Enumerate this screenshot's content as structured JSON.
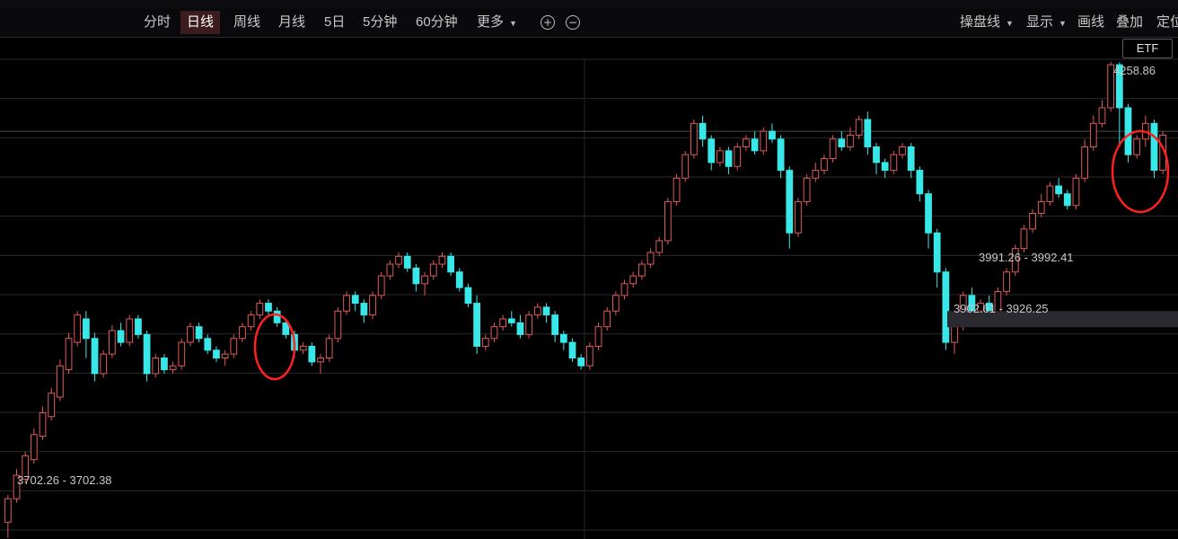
{
  "toolbar": {
    "tabs": [
      {
        "label": "分时",
        "active": false
      },
      {
        "label": "日线",
        "active": true
      },
      {
        "label": "周线",
        "active": false
      },
      {
        "label": "月线",
        "active": false
      },
      {
        "label": "5日",
        "active": false
      },
      {
        "label": "5分钟",
        "active": false
      },
      {
        "label": "60分钟",
        "active": false
      },
      {
        "label": "更多",
        "active": false
      }
    ],
    "zoom_in_icon": "plus-circle-icon",
    "zoom_out_icon": "minus-circle-icon",
    "right_items": [
      {
        "label": "操盘线",
        "dropdown": true
      },
      {
        "label": "显示",
        "dropdown": true
      },
      {
        "label": "画线",
        "dropdown": false
      },
      {
        "label": "叠加",
        "dropdown": false
      },
      {
        "label": "定位",
        "dropdown": false
      }
    ]
  },
  "etf_tag": "ETF",
  "chart_data": {
    "type": "candlestick",
    "high_label": "4258.86",
    "range_labels": [
      "3991.26 - 3992.41",
      "3902.61 - 3926.25",
      "3702.26 - 3702.38"
    ],
    "ylim": [
      3660,
      4262
    ],
    "colors": {
      "up": "#e05a5a",
      "down": "#38e8e8",
      "highlight": "#ff2020",
      "grid": "#2a2a2e"
    },
    "candles": [
      [
        3670,
        3700,
        3650,
        3705
      ],
      [
        3700,
        3730,
        3695,
        3738
      ],
      [
        3725,
        3755,
        3720,
        3760
      ],
      [
        3750,
        3782,
        3745,
        3790
      ],
      [
        3780,
        3810,
        3775,
        3818
      ],
      [
        3805,
        3835,
        3800,
        3842
      ],
      [
        3830,
        3870,
        3825,
        3878
      ],
      [
        3865,
        3905,
        3860,
        3912
      ],
      [
        3900,
        3935,
        3895,
        3940
      ],
      [
        3930,
        3905,
        3880,
        3940
      ],
      [
        3905,
        3860,
        3850,
        3912
      ],
      [
        3860,
        3885,
        3855,
        3890
      ],
      [
        3885,
        3915,
        3880,
        3922
      ],
      [
        3915,
        3900,
        3895,
        3925
      ],
      [
        3900,
        3930,
        3895,
        3935
      ],
      [
        3930,
        3910,
        3905,
        3935
      ],
      [
        3910,
        3860,
        3850,
        3915
      ],
      [
        3860,
        3880,
        3855,
        3885
      ],
      [
        3880,
        3865,
        3860,
        3885
      ],
      [
        3865,
        3870,
        3860,
        3875
      ],
      [
        3870,
        3900,
        3865,
        3905
      ],
      [
        3900,
        3920,
        3895,
        3925
      ],
      [
        3920,
        3905,
        3900,
        3925
      ],
      [
        3905,
        3890,
        3885,
        3910
      ],
      [
        3890,
        3880,
        3875,
        3895
      ],
      [
        3880,
        3885,
        3870,
        3890
      ],
      [
        3885,
        3905,
        3880,
        3910
      ],
      [
        3905,
        3920,
        3900,
        3925
      ],
      [
        3920,
        3935,
        3915,
        3940
      ],
      [
        3935,
        3950,
        3930,
        3955
      ],
      [
        3950,
        3940,
        3935,
        3955
      ],
      [
        3940,
        3925,
        3920,
        3945
      ],
      [
        3925,
        3910,
        3905,
        3930
      ],
      [
        3910,
        3890,
        3880,
        3915
      ],
      [
        3890,
        3895,
        3885,
        3900
      ],
      [
        3895,
        3875,
        3870,
        3900
      ],
      [
        3875,
        3880,
        3860,
        3885
      ],
      [
        3880,
        3905,
        3875,
        3910
      ],
      [
        3905,
        3940,
        3900,
        3945
      ],
      [
        3940,
        3960,
        3935,
        3965
      ],
      [
        3960,
        3950,
        3940,
        3965
      ],
      [
        3950,
        3935,
        3925,
        3955
      ],
      [
        3935,
        3960,
        3930,
        3965
      ],
      [
        3960,
        3985,
        3955,
        3990
      ],
      [
        3985,
        4000,
        3980,
        4005
      ],
      [
        4000,
        4010,
        3995,
        4015
      ],
      [
        4010,
        3995,
        3990,
        4015
      ],
      [
        3995,
        3975,
        3965,
        4000
      ],
      [
        3975,
        3985,
        3960,
        3990
      ],
      [
        3985,
        4000,
        3980,
        4005
      ],
      [
        4000,
        4010,
        3995,
        4015
      ],
      [
        4010,
        3990,
        3985,
        4015
      ],
      [
        3990,
        3970,
        3965,
        3995
      ],
      [
        3970,
        3950,
        3945,
        3975
      ],
      [
        3950,
        3895,
        3885,
        3960
      ],
      [
        3895,
        3905,
        3890,
        3910
      ],
      [
        3905,
        3920,
        3900,
        3925
      ],
      [
        3920,
        3930,
        3915,
        3935
      ],
      [
        3930,
        3925,
        3920,
        3940
      ],
      [
        3925,
        3910,
        3905,
        3935
      ],
      [
        3910,
        3935,
        3905,
        3940
      ],
      [
        3935,
        3945,
        3930,
        3950
      ],
      [
        3945,
        3935,
        3925,
        3950
      ],
      [
        3935,
        3910,
        3900,
        3940
      ],
      [
        3910,
        3900,
        3890,
        3915
      ],
      [
        3900,
        3880,
        3875,
        3905
      ],
      [
        3880,
        3870,
        3865,
        3885
      ],
      [
        3870,
        3895,
        3865,
        3900
      ],
      [
        3895,
        3920,
        3890,
        3925
      ],
      [
        3920,
        3940,
        3915,
        3945
      ],
      [
        3940,
        3960,
        3935,
        3965
      ],
      [
        3960,
        3975,
        3955,
        3980
      ],
      [
        3975,
        3985,
        3970,
        3990
      ],
      [
        3985,
        4000,
        3980,
        4005
      ],
      [
        4000,
        4015,
        3995,
        4020
      ],
      [
        4015,
        4030,
        4010,
        4035
      ],
      [
        4030,
        4080,
        4025,
        4085
      ],
      [
        4080,
        4110,
        4075,
        4115
      ],
      [
        4110,
        4140,
        4105,
        4145
      ],
      [
        4140,
        4180,
        4135,
        4185
      ],
      [
        4180,
        4160,
        4150,
        4190
      ],
      [
        4160,
        4130,
        4120,
        4165
      ],
      [
        4130,
        4145,
        4125,
        4150
      ],
      [
        4145,
        4125,
        4115,
        4150
      ],
      [
        4125,
        4150,
        4120,
        4155
      ],
      [
        4150,
        4160,
        4145,
        4165
      ],
      [
        4160,
        4145,
        4140,
        4170
      ],
      [
        4145,
        4170,
        4140,
        4175
      ],
      [
        4170,
        4160,
        4155,
        4180
      ],
      [
        4160,
        4120,
        4110,
        4165
      ],
      [
        4120,
        4040,
        4020,
        4125
      ],
      [
        4040,
        4080,
        4035,
        4085
      ],
      [
        4080,
        4110,
        4075,
        4115
      ],
      [
        4110,
        4120,
        4105,
        4130
      ],
      [
        4120,
        4135,
        4115,
        4140
      ],
      [
        4135,
        4160,
        4130,
        4165
      ],
      [
        4160,
        4150,
        4145,
        4170
      ],
      [
        4150,
        4165,
        4145,
        4175
      ],
      [
        4165,
        4185,
        4160,
        4190
      ],
      [
        4185,
        4150,
        4140,
        4195
      ],
      [
        4150,
        4130,
        4115,
        4155
      ],
      [
        4130,
        4120,
        4110,
        4135
      ],
      [
        4120,
        4140,
        4115,
        4145
      ],
      [
        4140,
        4150,
        4135,
        4155
      ],
      [
        4150,
        4120,
        4110,
        4155
      ],
      [
        4120,
        4090,
        4080,
        4125
      ],
      [
        4090,
        4040,
        4020,
        4095
      ],
      [
        4040,
        3990,
        3970,
        4045
      ],
      [
        3990,
        3900,
        3890,
        3995
      ],
      [
        3900,
        3920,
        3885,
        3925
      ],
      [
        3920,
        3960,
        3915,
        3965
      ],
      [
        3960,
        3940,
        3935,
        3970
      ],
      [
        3940,
        3950,
        3935,
        3955
      ],
      [
        3950,
        3935,
        3925,
        3960
      ],
      [
        3935,
        3965,
        3930,
        3970
      ],
      [
        3965,
        3990,
        3960,
        3995
      ],
      [
        3990,
        4020,
        3985,
        4025
      ],
      [
        4020,
        4045,
        4015,
        4050
      ],
      [
        4045,
        4065,
        4040,
        4070
      ],
      [
        4065,
        4080,
        4060,
        4090
      ],
      [
        4080,
        4100,
        4075,
        4105
      ],
      [
        4100,
        4090,
        4085,
        4110
      ],
      [
        4090,
        4075,
        4070,
        4095
      ],
      [
        4075,
        4110,
        4070,
        4115
      ],
      [
        4110,
        4150,
        4105,
        4160
      ],
      [
        4150,
        4180,
        4145,
        4190
      ],
      [
        4180,
        4200,
        4175,
        4210
      ],
      [
        4200,
        4255,
        4195,
        4258.86
      ],
      [
        4255,
        4200,
        4150,
        4258
      ],
      [
        4200,
        4140,
        4130,
        4205
      ],
      [
        4140,
        4160,
        4135,
        4165
      ],
      [
        4160,
        4180,
        4150,
        4190
      ],
      [
        4180,
        4120,
        4110,
        4185
      ],
      [
        4120,
        4165,
        4115,
        4170
      ]
    ]
  }
}
